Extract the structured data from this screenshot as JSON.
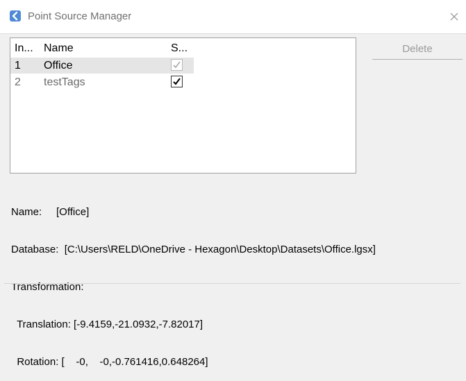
{
  "window": {
    "title": "Point Source Manager",
    "icon": "chevron-left-icon",
    "close_icon": "close-icon"
  },
  "list": {
    "columns": [
      "In...",
      "Name",
      "S..."
    ],
    "rows": [
      {
        "index": "1",
        "name": "Office",
        "checked": true,
        "enabled": false,
        "selected": true
      },
      {
        "index": "2",
        "name": "testTags",
        "checked": true,
        "enabled": true,
        "selected": false
      }
    ]
  },
  "buttons": {
    "delete_label": "Delete"
  },
  "info": {
    "name_line": "Name:     [Office]",
    "database_line": "Database:  [C:\\Users\\RELD\\OneDrive - Hexagon\\Desktop\\Datasets\\Office.lgsx]",
    "transformation_line": "Transformation:",
    "translation_line": "  Translation: [-9.4159,-21.0932,-7.82017]",
    "rotation_line": "  Rotation: [    -0,    -0,-0.761416,0.648264]"
  },
  "colors": {
    "accent": "#4f8ad6",
    "selected_row": "#e5e5e5",
    "disabled_text": "#9a9a9a"
  }
}
